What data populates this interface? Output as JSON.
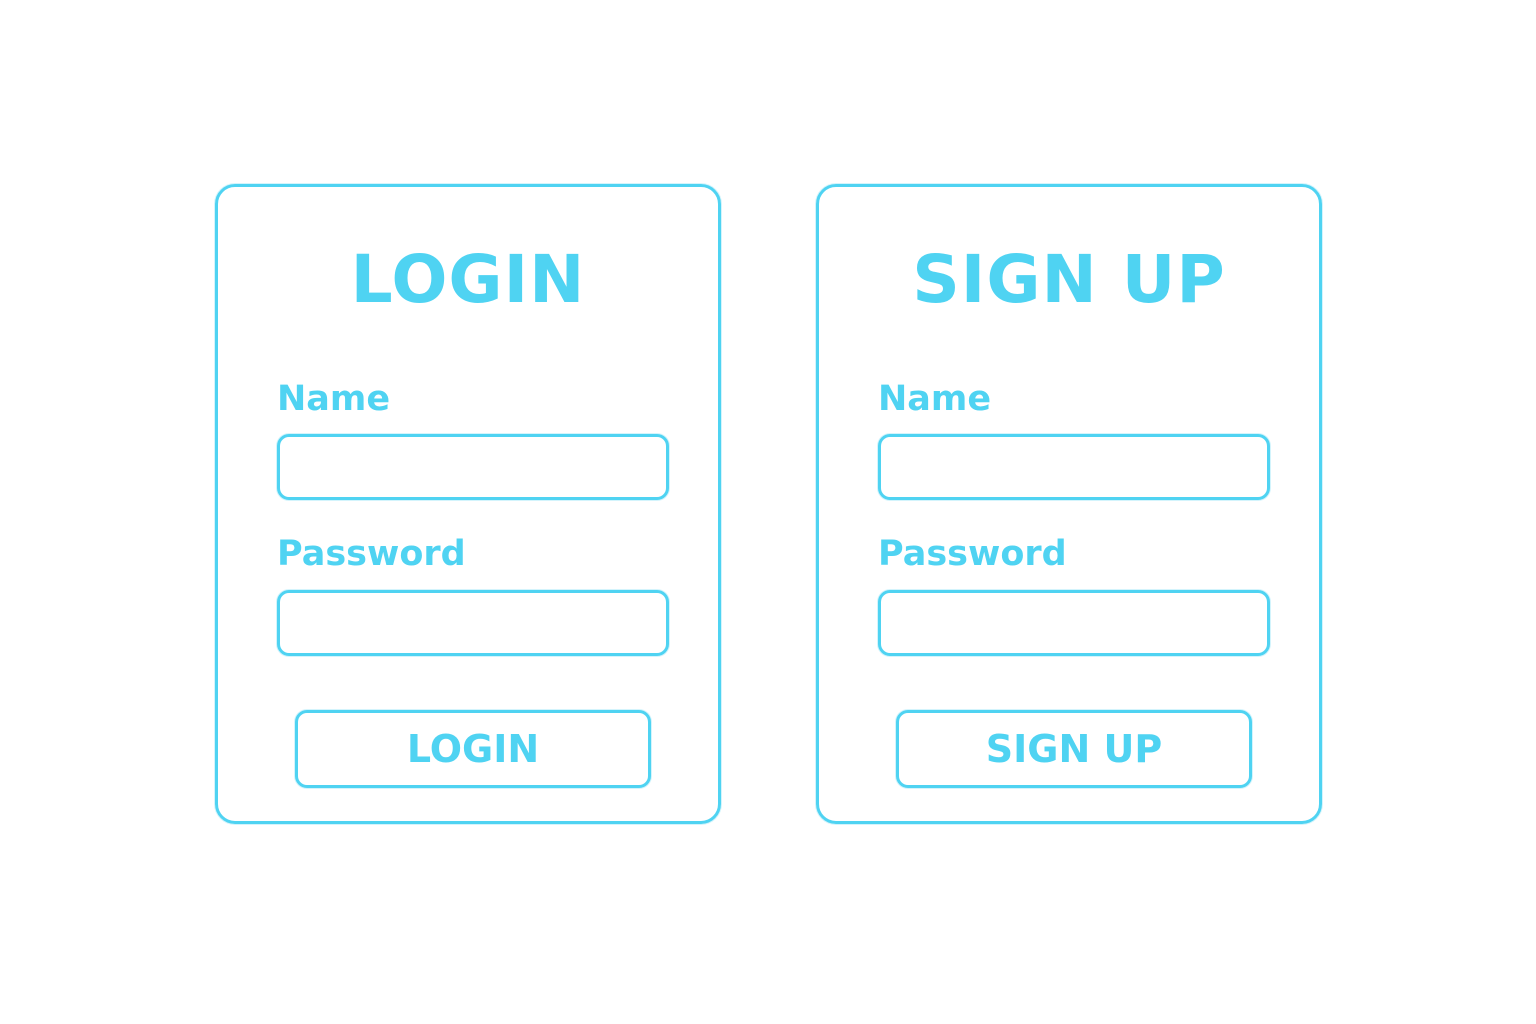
{
  "theme": {
    "accent": "#4fd3f2",
    "background": "#ffffff"
  },
  "login": {
    "title": "LOGIN",
    "name_label": "Name",
    "name_value": "",
    "password_label": "Password",
    "password_value": "",
    "button_label": "LOGIN"
  },
  "signup": {
    "title": "SIGN UP",
    "name_label": "Name",
    "name_value": "",
    "password_label": "Password",
    "password_value": "",
    "button_label": "SIGN UP"
  }
}
